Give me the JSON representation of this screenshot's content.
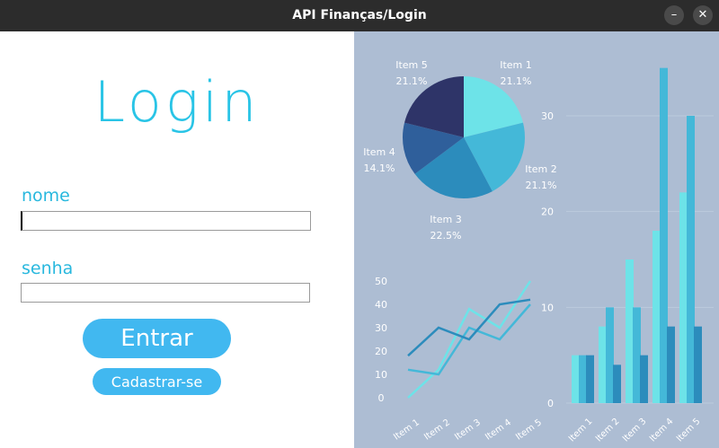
{
  "window": {
    "title": "API Finanças/Login",
    "minimize_glyph": "–",
    "close_glyph": "✕"
  },
  "login": {
    "title": "Login",
    "name_label": "nome",
    "name_value": "",
    "password_label": "senha",
    "password_value": "",
    "submit_label": "Entrar",
    "register_label": "Cadastrar-se"
  },
  "colors": {
    "accent": "#41b8f0",
    "title_color": "#29c4e6",
    "panel_bg": "#adbdd3"
  },
  "chart_data": [
    {
      "type": "pie",
      "categories": [
        "Item 1",
        "Item 2",
        "Item 3",
        "Item 4",
        "Item 5"
      ],
      "values": [
        21.1,
        21.1,
        22.5,
        14.1,
        21.1
      ],
      "labels": [
        "21.1%",
        "21.1%",
        "22.5%",
        "14.1%",
        "21.1%"
      ],
      "colors": [
        "#6de3e8",
        "#44b8d8",
        "#2c8cbc",
        "#2f5f9b",
        "#2e3468"
      ]
    },
    {
      "type": "line",
      "categories": [
        "Item 1",
        "Item 2",
        "Item 3",
        "Item 4",
        "Item 5"
      ],
      "ylim": [
        0,
        50
      ],
      "yticks": [
        "0",
        "10",
        "20",
        "30",
        "40",
        "50"
      ],
      "series": [
        {
          "values": [
            0,
            12,
            38,
            30,
            50
          ],
          "color": "#6de3e8"
        },
        {
          "values": [
            12,
            10,
            30,
            25,
            40
          ],
          "color": "#44b8d8"
        },
        {
          "values": [
            18,
            30,
            25,
            40,
            42
          ],
          "color": "#2c8cbc"
        }
      ]
    },
    {
      "type": "bar",
      "categories": [
        "Item 1",
        "Item 2",
        "Item 3",
        "Item 4",
        "Item 5"
      ],
      "ylim": [
        0,
        36
      ],
      "yticks": [
        "0",
        "10",
        "20",
        "30"
      ],
      "series": [
        {
          "values": [
            5,
            8,
            15,
            18,
            22
          ],
          "color": "#6de3e8"
        },
        {
          "values": [
            5,
            10,
            10,
            35,
            30
          ],
          "color": "#44b8d8"
        },
        {
          "values": [
            5,
            4,
            5,
            8,
            8
          ],
          "color": "#2c8cbc"
        }
      ]
    }
  ]
}
